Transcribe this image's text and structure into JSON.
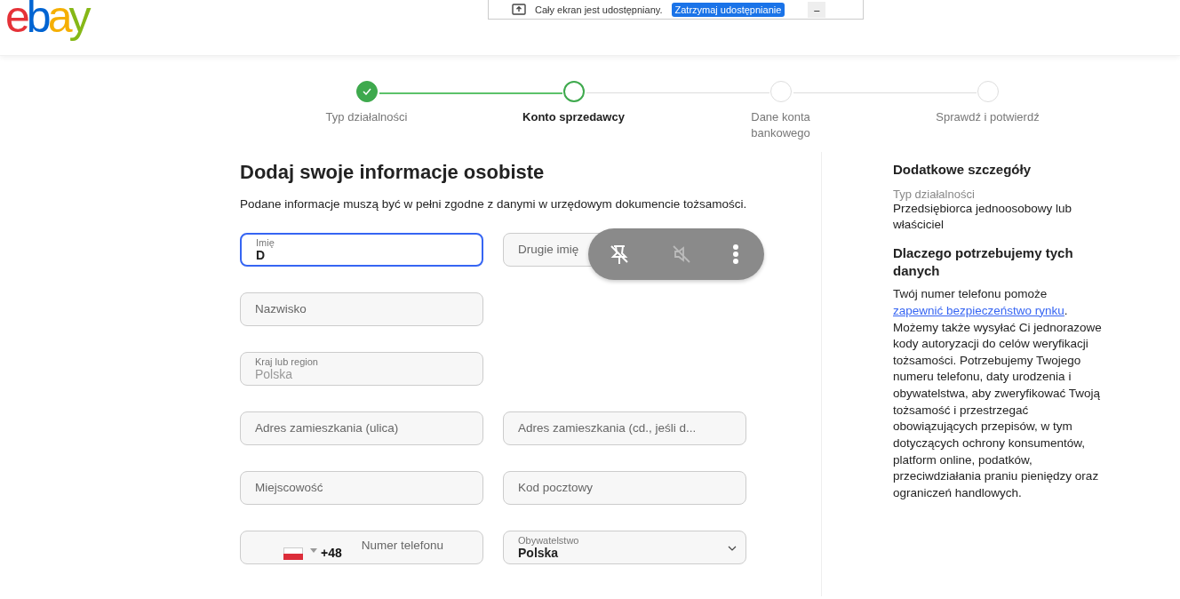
{
  "logo": {
    "letters": [
      {
        "text": "e",
        "color": "#e53238"
      },
      {
        "text": "b",
        "color": "#0064d2"
      },
      {
        "text": "a",
        "color": "#f5af02"
      },
      {
        "text": "y",
        "color": "#86b817"
      }
    ]
  },
  "share_bar": {
    "message": "Cały ekran jest udostępniany.",
    "stop_button": "Zatrzymaj udostępnianie",
    "minimize": "–"
  },
  "steps": [
    {
      "label": "Typ działalności",
      "kind": "done",
      "selected": false
    },
    {
      "label": "Konto sprzedawcy",
      "kind": "current",
      "selected": true
    },
    {
      "label": "Dane konta bankowego",
      "kind": "todo",
      "selected": false
    },
    {
      "label": "Sprawdź i potwierdź",
      "kind": "todo",
      "selected": false
    }
  ],
  "form": {
    "title": "Dodaj swoje informacje osobiste",
    "intro": "Podane informacje muszą być w pełni zgodne z danymi w urzędowym dokumencie tożsamości.",
    "rows": [
      [
        {
          "kind": "text",
          "label": "Imię",
          "value": "D",
          "focused": true
        },
        {
          "kind": "text",
          "placeholder": "Drugie imię",
          "focused": false
        }
      ],
      [
        {
          "kind": "text",
          "placeholder": "Nazwisko",
          "focused": false
        }
      ],
      [
        {
          "kind": "text",
          "label": "Kraj lub region",
          "value": "Polska",
          "disabled": true,
          "focused": false
        }
      ],
      [
        {
          "kind": "text",
          "placeholder": "Adres zamieszkania (ulica)",
          "focused": false
        },
        {
          "kind": "text",
          "placeholder": "Adres zamieszkania (cd., jeśli d...",
          "focused": false
        }
      ],
      [
        {
          "kind": "text",
          "placeholder": "Miejscowość",
          "focused": false
        },
        {
          "kind": "text",
          "placeholder": "Kod pocztowy",
          "focused": false
        }
      ],
      [
        {
          "kind": "phone",
          "code": "+48",
          "placeholder": "Numer telefonu",
          "focused": false
        },
        {
          "kind": "select",
          "label": "Obywatelstwo",
          "value": "Polska",
          "focused": false
        }
      ]
    ]
  },
  "sidebar": {
    "title": "Dodatkowe szczegóły",
    "detail_label": "Typ działalności",
    "detail_value": "Przedsiębiorca jednoosobowy lub właściciel",
    "why_title": "Dlaczego potrzebujemy tych danych",
    "why_before": "Twój numer telefonu pomoże",
    "why_link": "zapewnić bezpieczeństwo rynku",
    "why_after": ". Możemy także wysyłać Ci jednorazowe kody autoryzacji do celów weryfikacji tożsamości. Potrzebujemy Twojego numeru telefonu, daty urodzenia i obywatelstwa, aby zweryfikować Twoją tożsamość i przestrzegać obowiązujących przepisów, w tym dotyczących ochrony konsumentów, platform online, podatków, przeciwdziałania praniu pieniędzy oraz ograniczeń handlowych."
  }
}
